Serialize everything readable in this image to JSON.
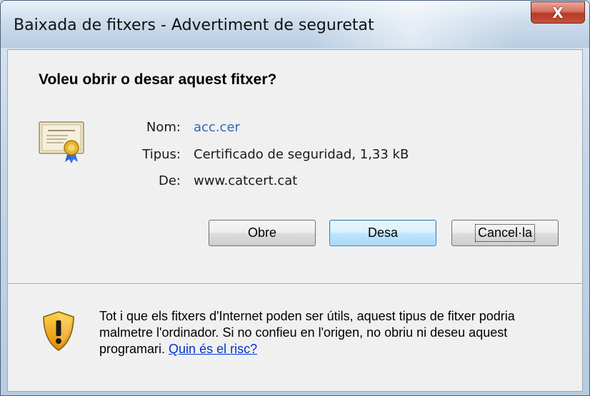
{
  "window": {
    "title": "Baixada de fitxers - Advertiment de seguretat",
    "close_glyph": "X"
  },
  "dialog": {
    "question": "Voleu obrir o desar aquest fitxer?",
    "file_icon": "certificate-icon",
    "fields": {
      "name_label": "Nom:",
      "name_value": "acc.cer",
      "type_label": "Tipus:",
      "type_value": "Certificado de seguridad, 1,33 kB",
      "from_label": "De:",
      "from_value": "www.catcert.cat"
    },
    "buttons": {
      "open": "Obre",
      "save": "Desa",
      "cancel": "Cancel·la"
    },
    "warning": {
      "icon": "security-shield-warning-icon",
      "text": "Tot i que els fitxers d'Internet poden ser útils, aquest tipus de fitxer podria malmetre l'ordinador. Si no confieu en l'origen, no obriu ni deseu aquest programari.",
      "link": "Quin és el risc?"
    }
  },
  "colors": {
    "link": "#0033cc",
    "file_name": "#3366bb",
    "close_button": "#c8523b",
    "default_button_border": "#3c7fb1"
  }
}
